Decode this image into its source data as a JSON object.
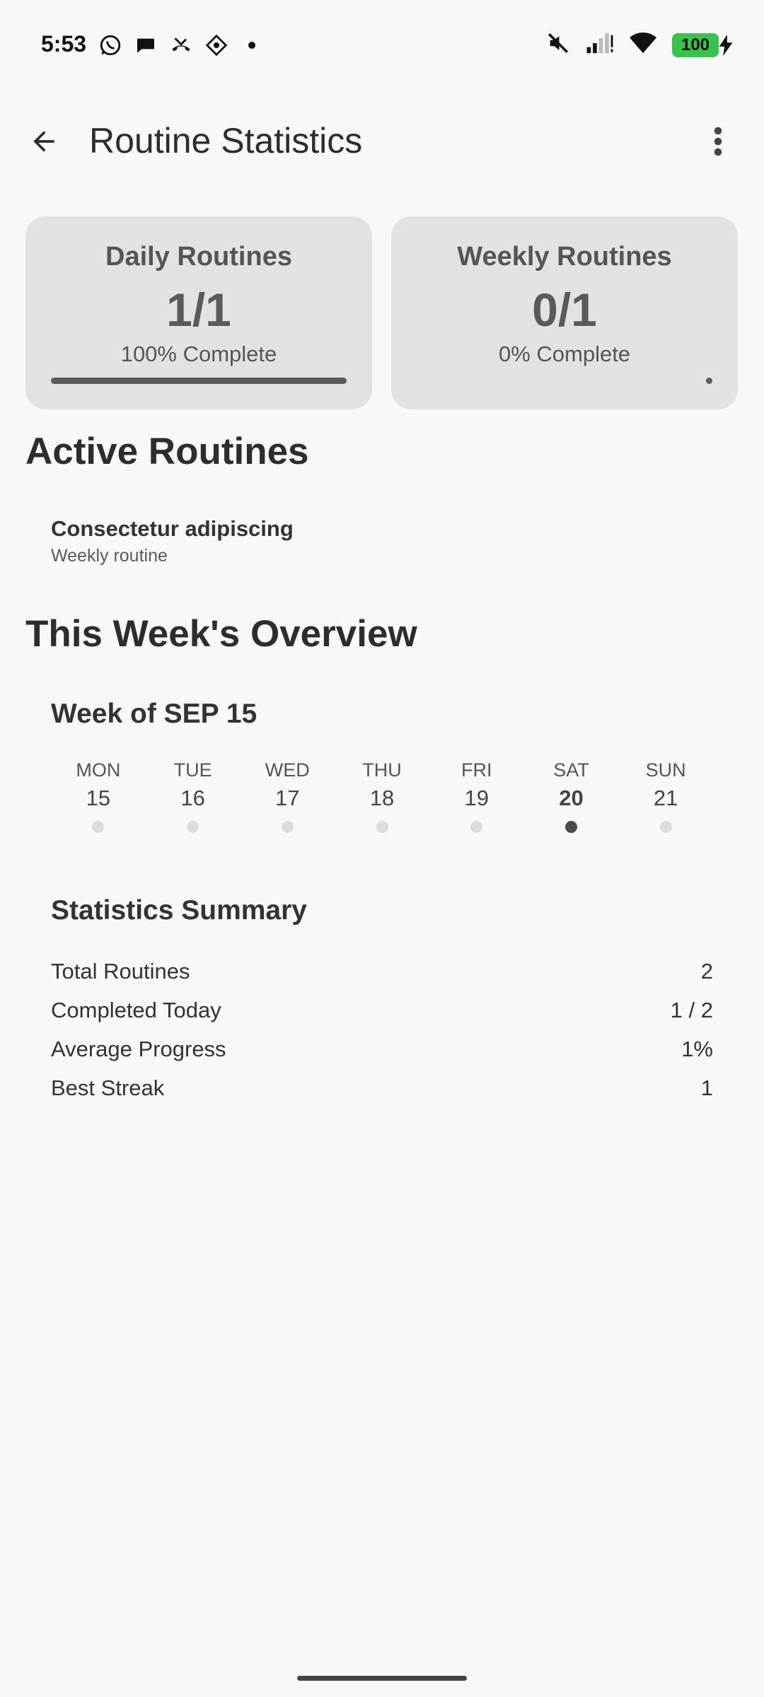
{
  "status_bar": {
    "time": "5:53",
    "battery": "100",
    "left_icons": [
      "whatsapp-icon",
      "chat-icon",
      "missed-call-icon",
      "app-icon",
      "dot-icon"
    ],
    "right_icons": [
      "mute-icon",
      "signal-icon",
      "wifi-icon",
      "battery-icon"
    ]
  },
  "app_bar": {
    "title": "Routine Statistics",
    "back_icon": "arrow-back-icon",
    "more_icon": "more-vert-icon"
  },
  "cards": {
    "daily": {
      "title": "Daily Routines",
      "count": "1/1",
      "percent_label": "100% Complete",
      "progress": 1.0
    },
    "weekly": {
      "title": "Weekly Routines",
      "count": "0/1",
      "percent_label": "0% Complete",
      "progress": 0.0
    }
  },
  "active_routines": {
    "heading": "Active Routines",
    "items": [
      {
        "name": "Consectetur adipiscing",
        "type": "Weekly routine"
      }
    ]
  },
  "overview": {
    "heading": "This Week's Overview",
    "week_title": "Week of SEP 15",
    "days": [
      {
        "name": "MON",
        "num": "15",
        "active": false
      },
      {
        "name": "TUE",
        "num": "16",
        "active": false
      },
      {
        "name": "WED",
        "num": "17",
        "active": false
      },
      {
        "name": "THU",
        "num": "18",
        "active": false
      },
      {
        "name": "FRI",
        "num": "19",
        "active": false
      },
      {
        "name": "SAT",
        "num": "20",
        "active": true
      },
      {
        "name": "SUN",
        "num": "21",
        "active": false
      }
    ]
  },
  "summary": {
    "title": "Statistics Summary",
    "rows": [
      {
        "label": "Total Routines",
        "value": "2"
      },
      {
        "label": "Completed Today",
        "value": "1 / 2"
      },
      {
        "label": "Average Progress",
        "value": "1%"
      },
      {
        "label": "Best Streak",
        "value": "1"
      }
    ]
  },
  "colors": {
    "background": "#f8f8f8",
    "card": "#e2e2e2",
    "progress": "#5a5a5a",
    "battery": "#3ac24c",
    "dot_inactive": "#dcdcdc",
    "dot_active": "#4b4b4b"
  }
}
